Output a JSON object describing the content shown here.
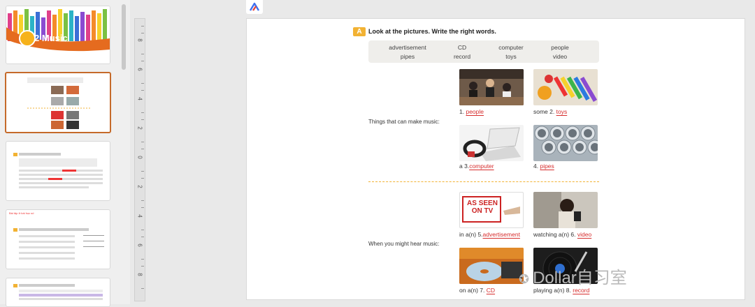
{
  "thumbnails": [
    {
      "title": "2 Music"
    },
    {},
    {},
    {
      "text": "Bài tập ở bài học số"
    },
    {}
  ],
  "ruler": {
    "labels": [
      "8",
      "6",
      "4",
      "2",
      "0",
      "2",
      "4",
      "6",
      "8"
    ]
  },
  "slide": {
    "badge": "A",
    "instruction": "Look at the pictures. Write the right words.",
    "words": [
      "advertisement",
      "CD",
      "computer",
      "people",
      "pipes",
      "record",
      "toys",
      "video"
    ],
    "section1_label": "Things that can make music:",
    "section2_label": "When you might hear music:",
    "items": [
      {
        "prefix": "1.",
        "answer": "people",
        "suffix": ""
      },
      {
        "prefix": "some 2.",
        "answer": "toys",
        "suffix": ""
      },
      {
        "prefix": "a 3.",
        "answer": "computer",
        "suffix": ""
      },
      {
        "prefix": "4.",
        "answer": "pipes",
        "suffix": ""
      },
      {
        "prefix": "in a(n) 5.",
        "answer": "advertisement",
        "suffix": ""
      },
      {
        "prefix": "watching a(n) 6.",
        "answer": "video",
        "suffix": ""
      },
      {
        "prefix": "on a(n) 7.",
        "answer": "CD",
        "suffix": ""
      },
      {
        "prefix": "playing a(n) 8.",
        "answer": "record",
        "suffix": ""
      }
    ],
    "as_seen_on_tv": "AS SEEN ON TV"
  },
  "watermark": "Dollar自习室"
}
